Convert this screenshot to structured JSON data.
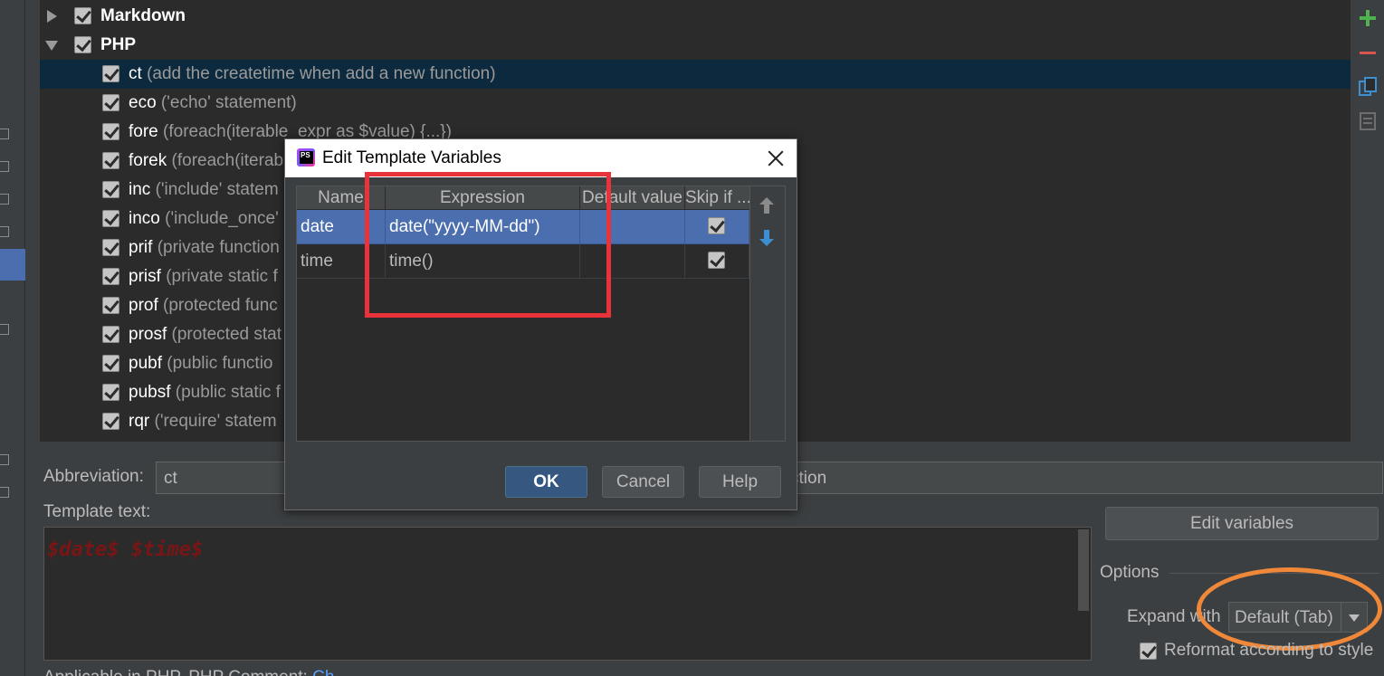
{
  "tree": {
    "groups": [
      {
        "label": "Markdown",
        "expanded": false
      },
      {
        "label": "PHP",
        "expanded": true
      }
    ],
    "items": [
      {
        "abbr": "ct",
        "desc": "(add the createtime when add a new function)",
        "selected": true
      },
      {
        "abbr": "eco",
        "desc": "('echo' statement)"
      },
      {
        "abbr": "fore",
        "desc": "(foreach(iterable_expr as $value) {...})"
      },
      {
        "abbr": "forek",
        "desc": "(foreach(iterab"
      },
      {
        "abbr": "inc",
        "desc": "('include' statem"
      },
      {
        "abbr": "inco",
        "desc": "('include_once'"
      },
      {
        "abbr": "prif",
        "desc": "(private function"
      },
      {
        "abbr": "prisf",
        "desc": "(private static f"
      },
      {
        "abbr": "prof",
        "desc": "(protected func"
      },
      {
        "abbr": "prosf",
        "desc": "(protected stat"
      },
      {
        "abbr": "pubf",
        "desc": "(public functio"
      },
      {
        "abbr": "pubsf",
        "desc": "(public static f"
      },
      {
        "abbr": "rqr",
        "desc": "('require' statem"
      }
    ]
  },
  "toolbar": {
    "add_icon": "plus-icon",
    "remove_icon": "minus-icon",
    "copy_icon": "copy-icon",
    "extra_icon": "list-icon"
  },
  "editor": {
    "abbreviation_label": "Abbreviation:",
    "abbreviation_value": "ct",
    "description_value": "ction",
    "template_label": "Template text:",
    "template_text": "$date$ $time$",
    "edit_variables_label": "Edit variables",
    "options_label": "Options",
    "expand_with_label": "Expand with",
    "expand_with_value": "Default (Tab)",
    "reformat_label": "Reformat according to style",
    "applicable_label": "Applicable in PHP, PHP Comment; ",
    "applicable_link": "Ch"
  },
  "dialog": {
    "title": "Edit Template Variables",
    "columns": [
      "Name",
      "Expression",
      "Default value",
      "Skip if ..."
    ],
    "rows": [
      {
        "name": "date",
        "expression": "date(\"yyyy-MM-dd\")",
        "default": "",
        "skip": true
      },
      {
        "name": "time",
        "expression": "time()",
        "default": "",
        "skip": true
      }
    ],
    "ok_label": "OK",
    "cancel_label": "Cancel",
    "help_label": "Help"
  },
  "colors": {
    "annotation_red": "#e8333a",
    "annotation_orange": "#f0883a",
    "selection": "#4b6eaf"
  }
}
